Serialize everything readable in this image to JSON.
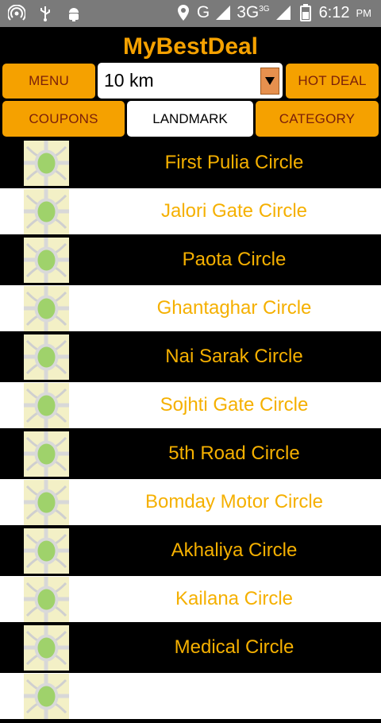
{
  "status": {
    "network_label": "G",
    "network_3g": "3G",
    "network_badge": "3G",
    "time": "6:12",
    "ampm": "PM",
    "icons": [
      "hotspot-icon",
      "usb-icon",
      "android-icon",
      "location-icon",
      "signal-icon",
      "battery-icon"
    ]
  },
  "app": {
    "title": "MyBestDeal"
  },
  "toolbar": {
    "menu_label": "MENU",
    "distance_value": "10 km",
    "hot_deal_label": "HOT DEAL"
  },
  "tabs": {
    "coupons_label": "COUPONS",
    "landmark_label": "LANDMARK",
    "category_label": "CATEGORY"
  },
  "landmarks": [
    "First Pulia Circle",
    "Jalori Gate Circle",
    "Paota Circle",
    "Ghantaghar Circle",
    "Nai Sarak Circle",
    "Sojhti Gate Circle",
    "5th Road Circle",
    "Bomday Motor Circle",
    "Akhaliya Circle",
    "Kailana Circle",
    "Medical Circle"
  ],
  "colors": {
    "accent": "#f5a100",
    "button_text": "#7a1f0a",
    "list_text": "#f5b000"
  }
}
